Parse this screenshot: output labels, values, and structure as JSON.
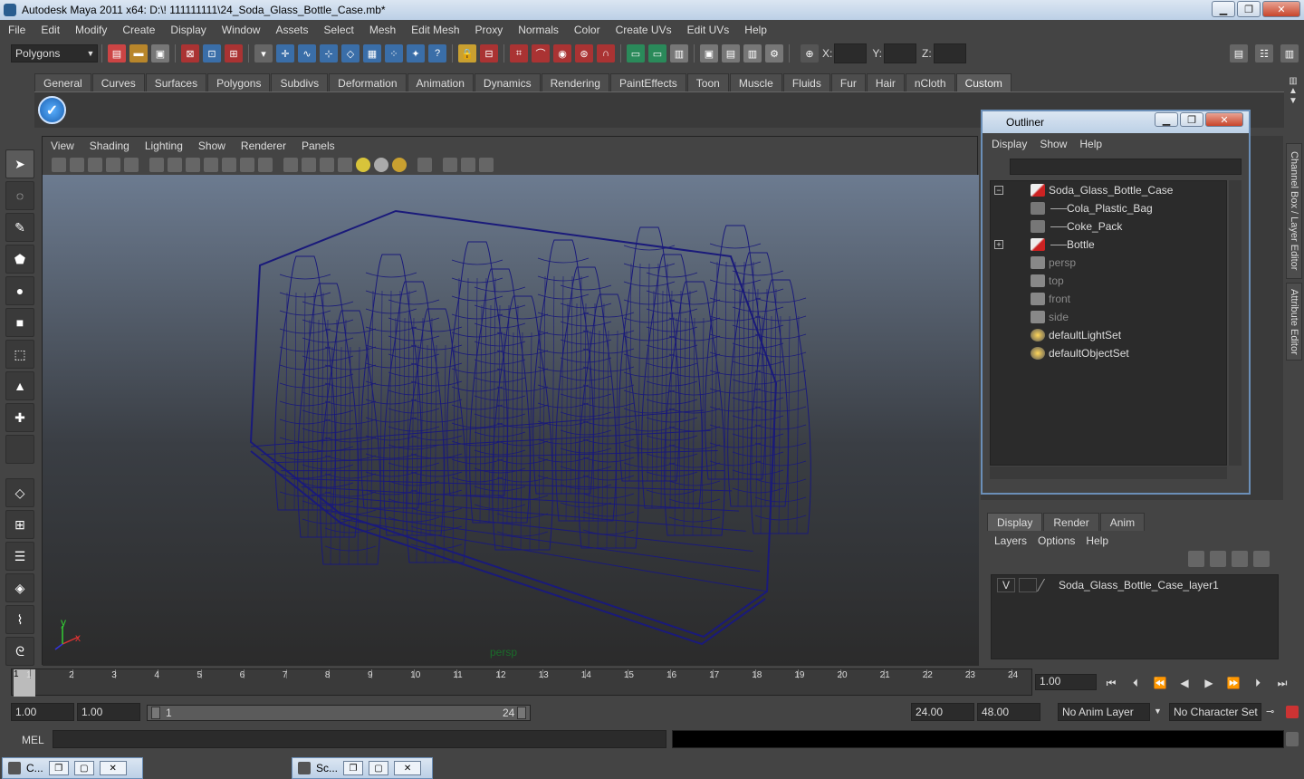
{
  "window": {
    "title": "Autodesk Maya 2011 x64: D:\\! 111111111\\24_Soda_Glass_Bottle_Case.mb*",
    "btn_min": "▁",
    "btn_max": "❐",
    "btn_close": "✕"
  },
  "menubar": [
    "File",
    "Edit",
    "Modify",
    "Create",
    "Display",
    "Window",
    "Assets",
    "Select",
    "Mesh",
    "Edit Mesh",
    "Proxy",
    "Normals",
    "Color",
    "Create UVs",
    "Edit UVs",
    "Help"
  ],
  "statusline": {
    "mode": "Polygons",
    "x_label": "X:",
    "y_label": "Y:",
    "z_label": "Z:"
  },
  "shelf_tabs": {
    "items": [
      "General",
      "Curves",
      "Surfaces",
      "Polygons",
      "Subdivs",
      "Deformation",
      "Animation",
      "Dynamics",
      "Rendering",
      "PaintEffects",
      "Toon",
      "Muscle",
      "Fluids",
      "Fur",
      "Hair",
      "nCloth",
      "Custom"
    ],
    "active": "Custom"
  },
  "viewport": {
    "menu": [
      "View",
      "Shading",
      "Lighting",
      "Show",
      "Renderer",
      "Panels"
    ],
    "camera_label": "persp",
    "axis_y": "y",
    "axis_x": "x",
    "wire_color": "#1a1a7a"
  },
  "outliner": {
    "title": "Outliner",
    "menu": [
      "Display",
      "Show",
      "Help"
    ],
    "items": [
      {
        "label": "Soda_Glass_Bottle_Case",
        "indent": 0,
        "expander": "−",
        "dim": false
      },
      {
        "label": "Cola_Plastic_Bag",
        "indent": 1,
        "expander": "",
        "dim": false
      },
      {
        "label": "Coke_Pack",
        "indent": 1,
        "expander": "",
        "dim": false
      },
      {
        "label": "Bottle",
        "indent": 1,
        "expander": "+",
        "dim": false
      },
      {
        "label": "persp",
        "indent": 0,
        "expander": "",
        "dim": true
      },
      {
        "label": "top",
        "indent": 0,
        "expander": "",
        "dim": true
      },
      {
        "label": "front",
        "indent": 0,
        "expander": "",
        "dim": true
      },
      {
        "label": "side",
        "indent": 0,
        "expander": "",
        "dim": true
      },
      {
        "label": "defaultLightSet",
        "indent": 0,
        "expander": "",
        "dim": false
      },
      {
        "label": "defaultObjectSet",
        "indent": 0,
        "expander": "",
        "dim": false
      }
    ]
  },
  "side_tabs": {
    "channel_box": "Channel Box / Layer Editor",
    "attribute_editor": "Attribute Editor"
  },
  "layer_editor": {
    "tabs": [
      "Display",
      "Render",
      "Anim"
    ],
    "active": "Display",
    "menu": [
      "Layers",
      "Options",
      "Help"
    ],
    "layers": [
      {
        "vis": "V",
        "name": "Soda_Glass_Bottle_Case_layer1"
      }
    ]
  },
  "timeline": {
    "ticks": [
      "1",
      "2",
      "3",
      "4",
      "5",
      "6",
      "7",
      "8",
      "9",
      "10",
      "11",
      "12",
      "13",
      "14",
      "15",
      "16",
      "17",
      "18",
      "19",
      "20",
      "21",
      "22",
      "23",
      "24"
    ],
    "current_frame": "1",
    "current_time": "1.00"
  },
  "range": {
    "start": "1.00",
    "playback_start": "1.00",
    "slider_min": "1",
    "slider_max": "24",
    "playback_end": "24.00",
    "end": "48.00",
    "anim_layer": "No Anim Layer",
    "character_set": "No Character Set"
  },
  "command_line": {
    "label": "MEL"
  },
  "taskbar": [
    {
      "label": "C..."
    },
    {
      "label": "Sc..."
    }
  ]
}
